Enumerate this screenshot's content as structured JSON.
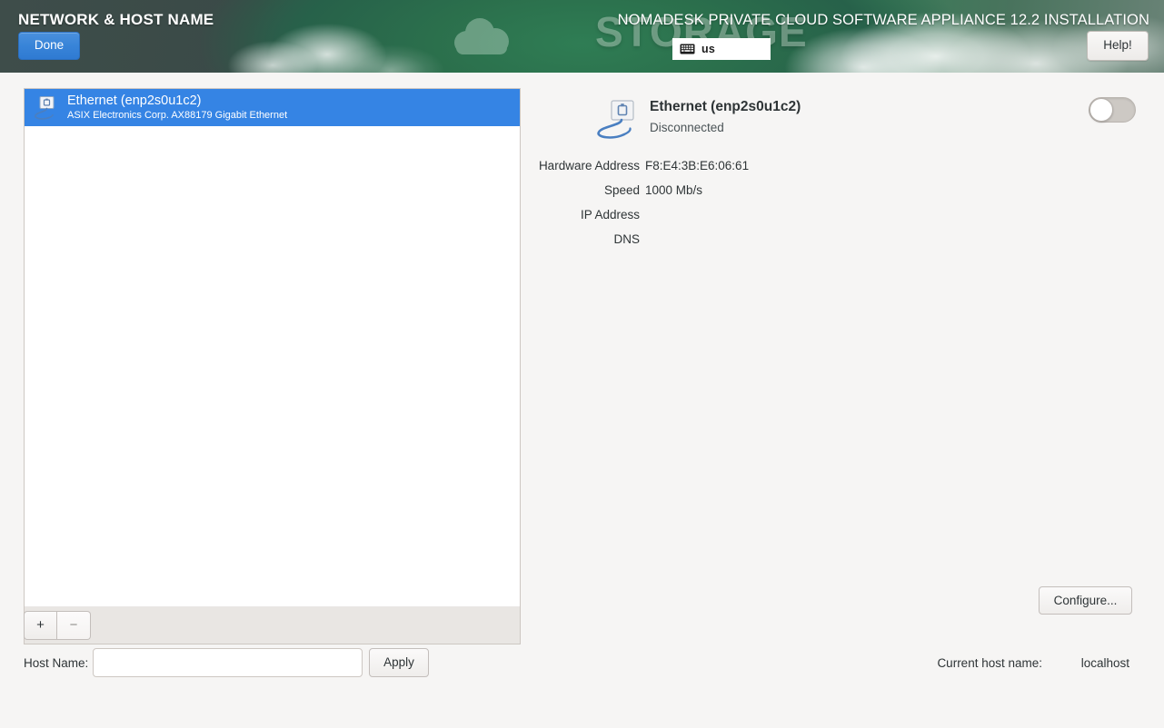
{
  "header": {
    "screen_title": "NETWORK & HOST NAME",
    "product_title": "NOMADESK PRIVATE CLOUD SOFTWARE APPLIANCE 12.2 INSTALLATION",
    "background_word": "STORAGE",
    "done_label": "Done",
    "help_label": "Help!",
    "keyboard_layout": "us",
    "keyboard_icon": "keyboard-icon",
    "accent_color": "#3584e4",
    "header_green": "#2d7a52",
    "header_slate": "#3e4d4a"
  },
  "device_list": {
    "devices": [
      {
        "name": "Ethernet (enp2s0u1c2)",
        "description": "ASIX Electronics Corp. AX88179 Gigabit Ethernet",
        "icon": "wired-network-icon",
        "selected": true
      }
    ],
    "toolbar": {
      "add_label": "+",
      "remove_label": "−"
    }
  },
  "detail": {
    "title": "Ethernet (enp2s0u1c2)",
    "status": "Disconnected",
    "icon": "wired-network-icon",
    "toggle_state": "off",
    "fields": [
      {
        "label": "Hardware Address",
        "value": "F8:E4:3B:E6:06:61"
      },
      {
        "label": "Speed",
        "value": "1000 Mb/s"
      },
      {
        "label": "IP Address",
        "value": ""
      },
      {
        "label": "DNS",
        "value": ""
      }
    ],
    "configure_label": "Configure..."
  },
  "hostname": {
    "label": "Host Name:",
    "value": "",
    "placeholder": "",
    "apply_label": "Apply",
    "current_label": "Current host name:",
    "current_value": "localhost"
  }
}
